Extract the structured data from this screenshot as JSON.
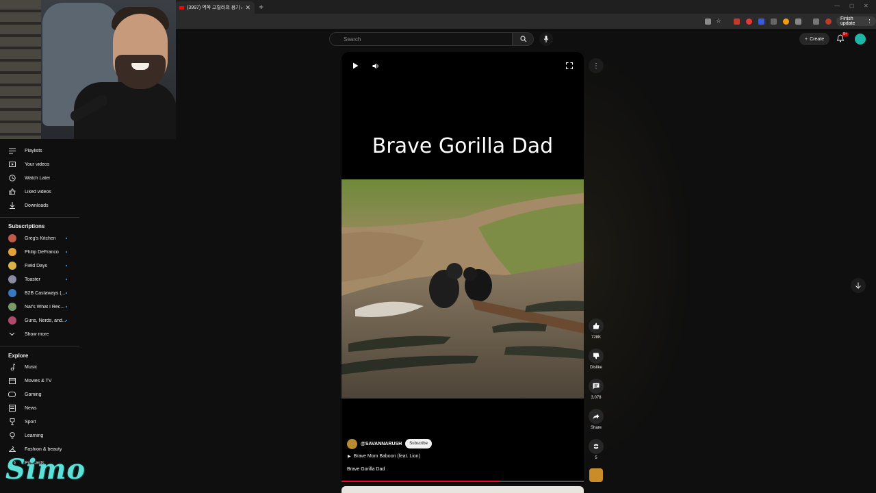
{
  "browser": {
    "tab_title": "(3997) 역쪽 고릴라의 용기 A Fi",
    "new_tab": "+",
    "close_tab": "✕",
    "finish_update": "Finish update"
  },
  "header": {
    "search_placeholder": "Search",
    "create_label": "Create",
    "notifications_badge": "9+"
  },
  "sidebar": {
    "you_items": [
      {
        "label": "Playlists",
        "icon": "playlist-icon"
      },
      {
        "label": "Your videos",
        "icon": "your-videos-icon"
      },
      {
        "label": "Watch Later",
        "icon": "clock-icon"
      },
      {
        "label": "Liked videos",
        "icon": "thumbs-up-icon"
      },
      {
        "label": "Downloads",
        "icon": "download-icon"
      }
    ],
    "subscriptions_heading": "Subscriptions",
    "subscriptions": [
      {
        "label": "Greg's Kitchen",
        "color": "#c05a4a"
      },
      {
        "label": "Philip DeFranco",
        "color": "#e0a33a"
      },
      {
        "label": "Field Days",
        "color": "#d9b24a"
      },
      {
        "label": "Toaster",
        "color": "#8a8aa0"
      },
      {
        "label": "B2B Castaways (...",
        "color": "#3a78c0"
      },
      {
        "label": "Nat's What I Rec...",
        "color": "#7a9a6a"
      },
      {
        "label": "Guns, Nerds, and...",
        "color": "#b04a6a"
      }
    ],
    "show_more": "Show more",
    "explore_heading": "Explore",
    "explore_items": [
      {
        "label": "Music",
        "icon": "music-note-icon"
      },
      {
        "label": "Movies & TV",
        "icon": "film-icon"
      },
      {
        "label": "Gaming",
        "icon": "gamepad-icon"
      },
      {
        "label": "News",
        "icon": "news-icon"
      },
      {
        "label": "Sport",
        "icon": "trophy-icon"
      },
      {
        "label": "Learning",
        "icon": "lightbulb-icon"
      },
      {
        "label": "Fashion & beauty",
        "icon": "hanger-icon"
      },
      {
        "label": "Podcasts",
        "icon": "podcast-icon"
      }
    ],
    "streamer_logo": "Simo"
  },
  "video": {
    "overlay_title": "Brave Gorilla Dad",
    "channel": "@SAVANNARUSH",
    "subscribe_label": "Subscribe",
    "music": "Brave Mom Baboon (feat. Lion)",
    "caption": "Brave Gorilla Dad",
    "progress": 0.65
  },
  "actions": {
    "likes": "728K",
    "dislike": "Dislike",
    "comments": "3,078",
    "share": "Share",
    "remix": "5"
  },
  "colors": {
    "accent": "#ff0033",
    "link_dot": "#3ea6ff",
    "background": "#0f0f0f"
  }
}
